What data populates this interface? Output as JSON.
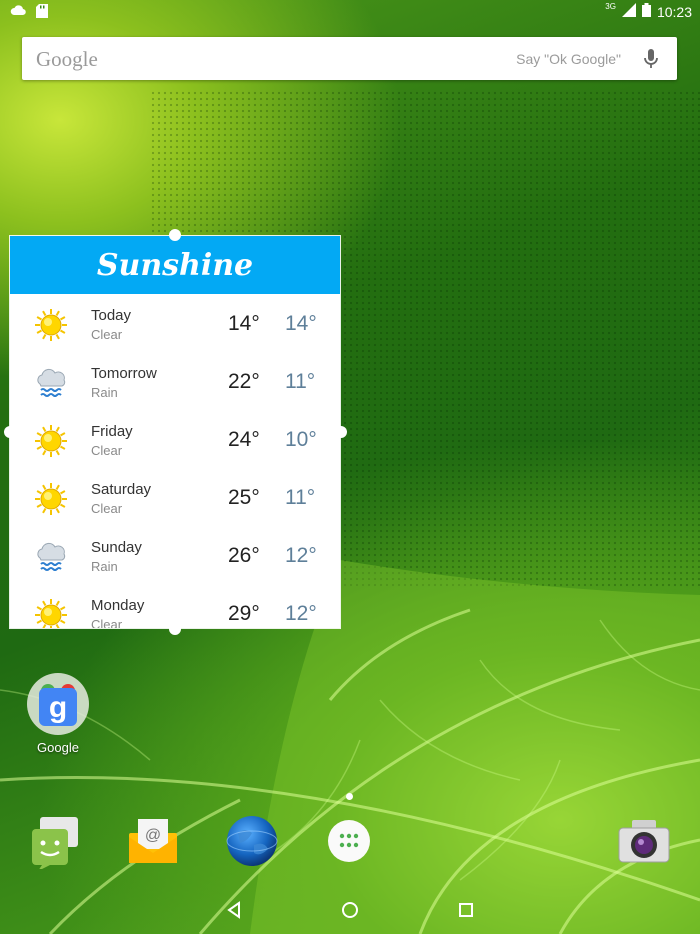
{
  "status_bar": {
    "network": "3G",
    "time": "10:23",
    "left_icons": [
      "cloud-download-icon",
      "sd-card-icon"
    ]
  },
  "search": {
    "logo": "Google",
    "hint": "Say \"Ok Google\""
  },
  "widget": {
    "title": "Sunshine",
    "accent_color": "#03a9f4",
    "forecast": [
      {
        "day": "Today",
        "condition": "Clear",
        "high": "14°",
        "low": "14°",
        "icon": "sun-icon"
      },
      {
        "day": "Tomorrow",
        "condition": "Rain",
        "high": "22°",
        "low": "11°",
        "icon": "rain-cloud-icon"
      },
      {
        "day": "Friday",
        "condition": "Clear",
        "high": "24°",
        "low": "10°",
        "icon": "sun-icon"
      },
      {
        "day": "Saturday",
        "condition": "Clear",
        "high": "25°",
        "low": "11°",
        "icon": "sun-icon"
      },
      {
        "day": "Sunday",
        "condition": "Rain",
        "high": "26°",
        "low": "12°",
        "icon": "rain-cloud-icon"
      },
      {
        "day": "Monday",
        "condition": "Clear",
        "high": "29°",
        "low": "12°",
        "icon": "sun-icon"
      }
    ]
  },
  "home": {
    "google_folder_label": "Google"
  },
  "dock": [
    "messenger-icon",
    "email-icon",
    "browser-icon",
    "app-drawer-icon",
    "camera-icon"
  ],
  "nav": [
    "back-icon",
    "home-icon",
    "recents-icon"
  ]
}
